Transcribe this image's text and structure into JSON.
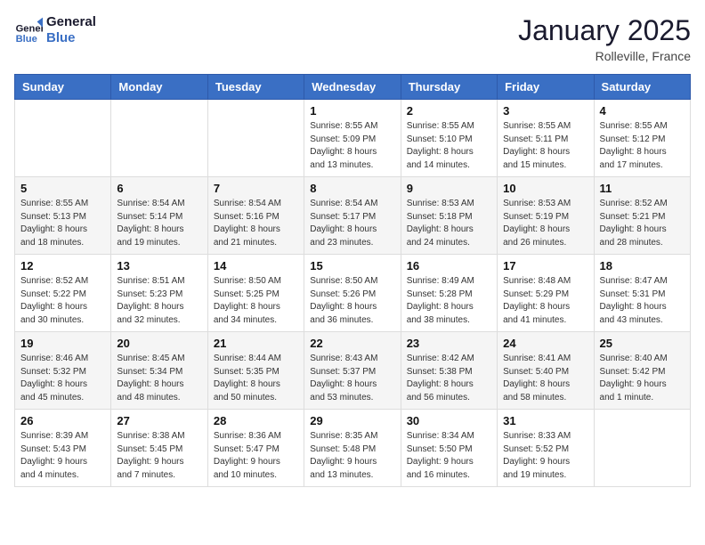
{
  "logo": {
    "line1": "General",
    "line2": "Blue"
  },
  "title": "January 2025",
  "location": "Rolleville, France",
  "weekdays": [
    "Sunday",
    "Monday",
    "Tuesday",
    "Wednesday",
    "Thursday",
    "Friday",
    "Saturday"
  ],
  "weeks": [
    [
      {
        "day": "",
        "info": ""
      },
      {
        "day": "",
        "info": ""
      },
      {
        "day": "",
        "info": ""
      },
      {
        "day": "1",
        "info": "Sunrise: 8:55 AM\nSunset: 5:09 PM\nDaylight: 8 hours\nand 13 minutes."
      },
      {
        "day": "2",
        "info": "Sunrise: 8:55 AM\nSunset: 5:10 PM\nDaylight: 8 hours\nand 14 minutes."
      },
      {
        "day": "3",
        "info": "Sunrise: 8:55 AM\nSunset: 5:11 PM\nDaylight: 8 hours\nand 15 minutes."
      },
      {
        "day": "4",
        "info": "Sunrise: 8:55 AM\nSunset: 5:12 PM\nDaylight: 8 hours\nand 17 minutes."
      }
    ],
    [
      {
        "day": "5",
        "info": "Sunrise: 8:55 AM\nSunset: 5:13 PM\nDaylight: 8 hours\nand 18 minutes."
      },
      {
        "day": "6",
        "info": "Sunrise: 8:54 AM\nSunset: 5:14 PM\nDaylight: 8 hours\nand 19 minutes."
      },
      {
        "day": "7",
        "info": "Sunrise: 8:54 AM\nSunset: 5:16 PM\nDaylight: 8 hours\nand 21 minutes."
      },
      {
        "day": "8",
        "info": "Sunrise: 8:54 AM\nSunset: 5:17 PM\nDaylight: 8 hours\nand 23 minutes."
      },
      {
        "day": "9",
        "info": "Sunrise: 8:53 AM\nSunset: 5:18 PM\nDaylight: 8 hours\nand 24 minutes."
      },
      {
        "day": "10",
        "info": "Sunrise: 8:53 AM\nSunset: 5:19 PM\nDaylight: 8 hours\nand 26 minutes."
      },
      {
        "day": "11",
        "info": "Sunrise: 8:52 AM\nSunset: 5:21 PM\nDaylight: 8 hours\nand 28 minutes."
      }
    ],
    [
      {
        "day": "12",
        "info": "Sunrise: 8:52 AM\nSunset: 5:22 PM\nDaylight: 8 hours\nand 30 minutes."
      },
      {
        "day": "13",
        "info": "Sunrise: 8:51 AM\nSunset: 5:23 PM\nDaylight: 8 hours\nand 32 minutes."
      },
      {
        "day": "14",
        "info": "Sunrise: 8:50 AM\nSunset: 5:25 PM\nDaylight: 8 hours\nand 34 minutes."
      },
      {
        "day": "15",
        "info": "Sunrise: 8:50 AM\nSunset: 5:26 PM\nDaylight: 8 hours\nand 36 minutes."
      },
      {
        "day": "16",
        "info": "Sunrise: 8:49 AM\nSunset: 5:28 PM\nDaylight: 8 hours\nand 38 minutes."
      },
      {
        "day": "17",
        "info": "Sunrise: 8:48 AM\nSunset: 5:29 PM\nDaylight: 8 hours\nand 41 minutes."
      },
      {
        "day": "18",
        "info": "Sunrise: 8:47 AM\nSunset: 5:31 PM\nDaylight: 8 hours\nand 43 minutes."
      }
    ],
    [
      {
        "day": "19",
        "info": "Sunrise: 8:46 AM\nSunset: 5:32 PM\nDaylight: 8 hours\nand 45 minutes."
      },
      {
        "day": "20",
        "info": "Sunrise: 8:45 AM\nSunset: 5:34 PM\nDaylight: 8 hours\nand 48 minutes."
      },
      {
        "day": "21",
        "info": "Sunrise: 8:44 AM\nSunset: 5:35 PM\nDaylight: 8 hours\nand 50 minutes."
      },
      {
        "day": "22",
        "info": "Sunrise: 8:43 AM\nSunset: 5:37 PM\nDaylight: 8 hours\nand 53 minutes."
      },
      {
        "day": "23",
        "info": "Sunrise: 8:42 AM\nSunset: 5:38 PM\nDaylight: 8 hours\nand 56 minutes."
      },
      {
        "day": "24",
        "info": "Sunrise: 8:41 AM\nSunset: 5:40 PM\nDaylight: 8 hours\nand 58 minutes."
      },
      {
        "day": "25",
        "info": "Sunrise: 8:40 AM\nSunset: 5:42 PM\nDaylight: 9 hours\nand 1 minute."
      }
    ],
    [
      {
        "day": "26",
        "info": "Sunrise: 8:39 AM\nSunset: 5:43 PM\nDaylight: 9 hours\nand 4 minutes."
      },
      {
        "day": "27",
        "info": "Sunrise: 8:38 AM\nSunset: 5:45 PM\nDaylight: 9 hours\nand 7 minutes."
      },
      {
        "day": "28",
        "info": "Sunrise: 8:36 AM\nSunset: 5:47 PM\nDaylight: 9 hours\nand 10 minutes."
      },
      {
        "day": "29",
        "info": "Sunrise: 8:35 AM\nSunset: 5:48 PM\nDaylight: 9 hours\nand 13 minutes."
      },
      {
        "day": "30",
        "info": "Sunrise: 8:34 AM\nSunset: 5:50 PM\nDaylight: 9 hours\nand 16 minutes."
      },
      {
        "day": "31",
        "info": "Sunrise: 8:33 AM\nSunset: 5:52 PM\nDaylight: 9 hours\nand 19 minutes."
      },
      {
        "day": "",
        "info": ""
      }
    ]
  ]
}
